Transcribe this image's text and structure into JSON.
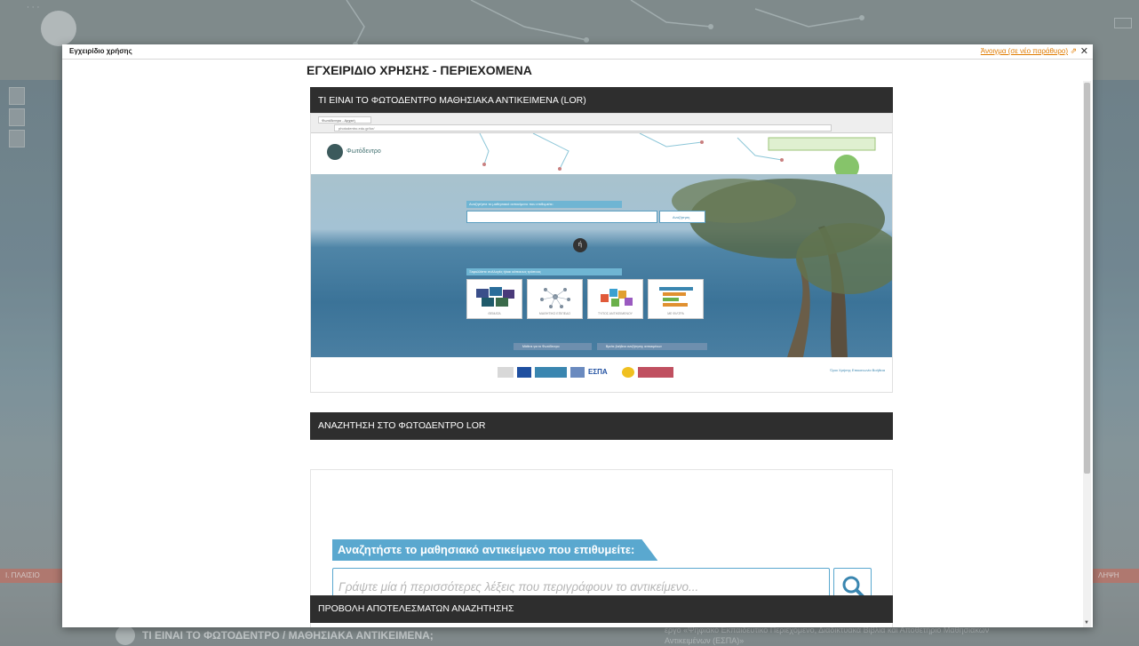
{
  "background": {
    "bottom_title": "ΤΙ ΕΙΝΑΙ ΤΟ ΦΩΤΟΔΕΝΤΡΟ / ΜΑΘΗΣΙΑΚΑ ΑΝΤΙΚΕΙΜΕΝΑ;",
    "bottom_note": "έργο «Ψηφιακό Εκπαιδευτικό Περιεχόμενο, Διαδικτυακά Βιβλία και Αποθετήριο Μαθησιακών Αντικειμένων (ΕΣΠΑ)»",
    "left_bar_text": "Ι. ΠΛΑΙΣΙΟ",
    "right_bar_text": "ΛΗΨΗ"
  },
  "modal": {
    "title": "Εγχειρίδιο χρήσης",
    "popout_link": "Άνοιγμα (σε νέο παράθυρο)",
    "close_symbol": "✕"
  },
  "doc": {
    "title": "ΕΓΧΕΙΡΙΔΙΟ ΧΡΗΣΗΣ - ΠΕΡΙΕΧΟΜΕΝΑ",
    "sections": [
      {
        "heading": "ΤΙ ΕΙΝΑΙ ΤΟ ΦΩΤΟΔΕΝΤΡΟ ΜΑΘΗΣΙΑΚΑ ΑΝΤΙΚΕΙΜΕΝΑ (LOR)"
      },
      {
        "heading": "ΑΝΑΖΗΤΗΣΗ ΣΤΟ ΦΩΤΟΔΕΝΤΡΟ LOR"
      },
      {
        "heading": "ΠΡΟΒΟΛΗ ΑΠΟΤΕΛΕΣΜΑΤΩΝ ΑΝΑΖΗΤΗΣΗΣ"
      }
    ]
  },
  "shot1": {
    "tab": "Φωτόδεντρο - Αρχική",
    "url": "photodentro.edu.gr/lor/",
    "logo_text": "Φωτόδεντρο",
    "search_label": "Αναζητήστε το μαθησιακό αντικείμενο που επιθυμείτε:",
    "search_button": "Αναζήτηση",
    "or": "ή",
    "categories_label": "Ξεφυλλίστε συλλογές ή/και κάποιους τρόπους",
    "cards": [
      "ΘΕΜΑΤΑ",
      "ΜΑΘΗΤΙΚΟ ΕΠΙΠΕΔΟ",
      "ΤΥΠΟΣ ΑΝΤΙΚΕΙΜΕΝΟΥ",
      "ΜΕ ΦΙΛΤΡΑ"
    ],
    "bottom_buttons": [
      "Μάθετε για το Φωτόδεντρο",
      "Βρείτε βοήθεια αναζήτησης αντικειμένων"
    ],
    "footer_links": "Όροι Χρήσης   Επικοινωνία   Βοήθεια",
    "espa": "ΕΣΠΑ"
  },
  "search_section": {
    "label": "Αναζητήστε το μαθησιακό αντικείμενο που επιθυμείτε:",
    "placeholder": "Γράψτε μία ή περισσότερες λέξεις που περιγράφουν το αντικείμενο..."
  },
  "colors": {
    "section_header_bg": "#2e2e2e",
    "accent_blue": "#5aa8cf",
    "link_orange": "#e07b00"
  }
}
